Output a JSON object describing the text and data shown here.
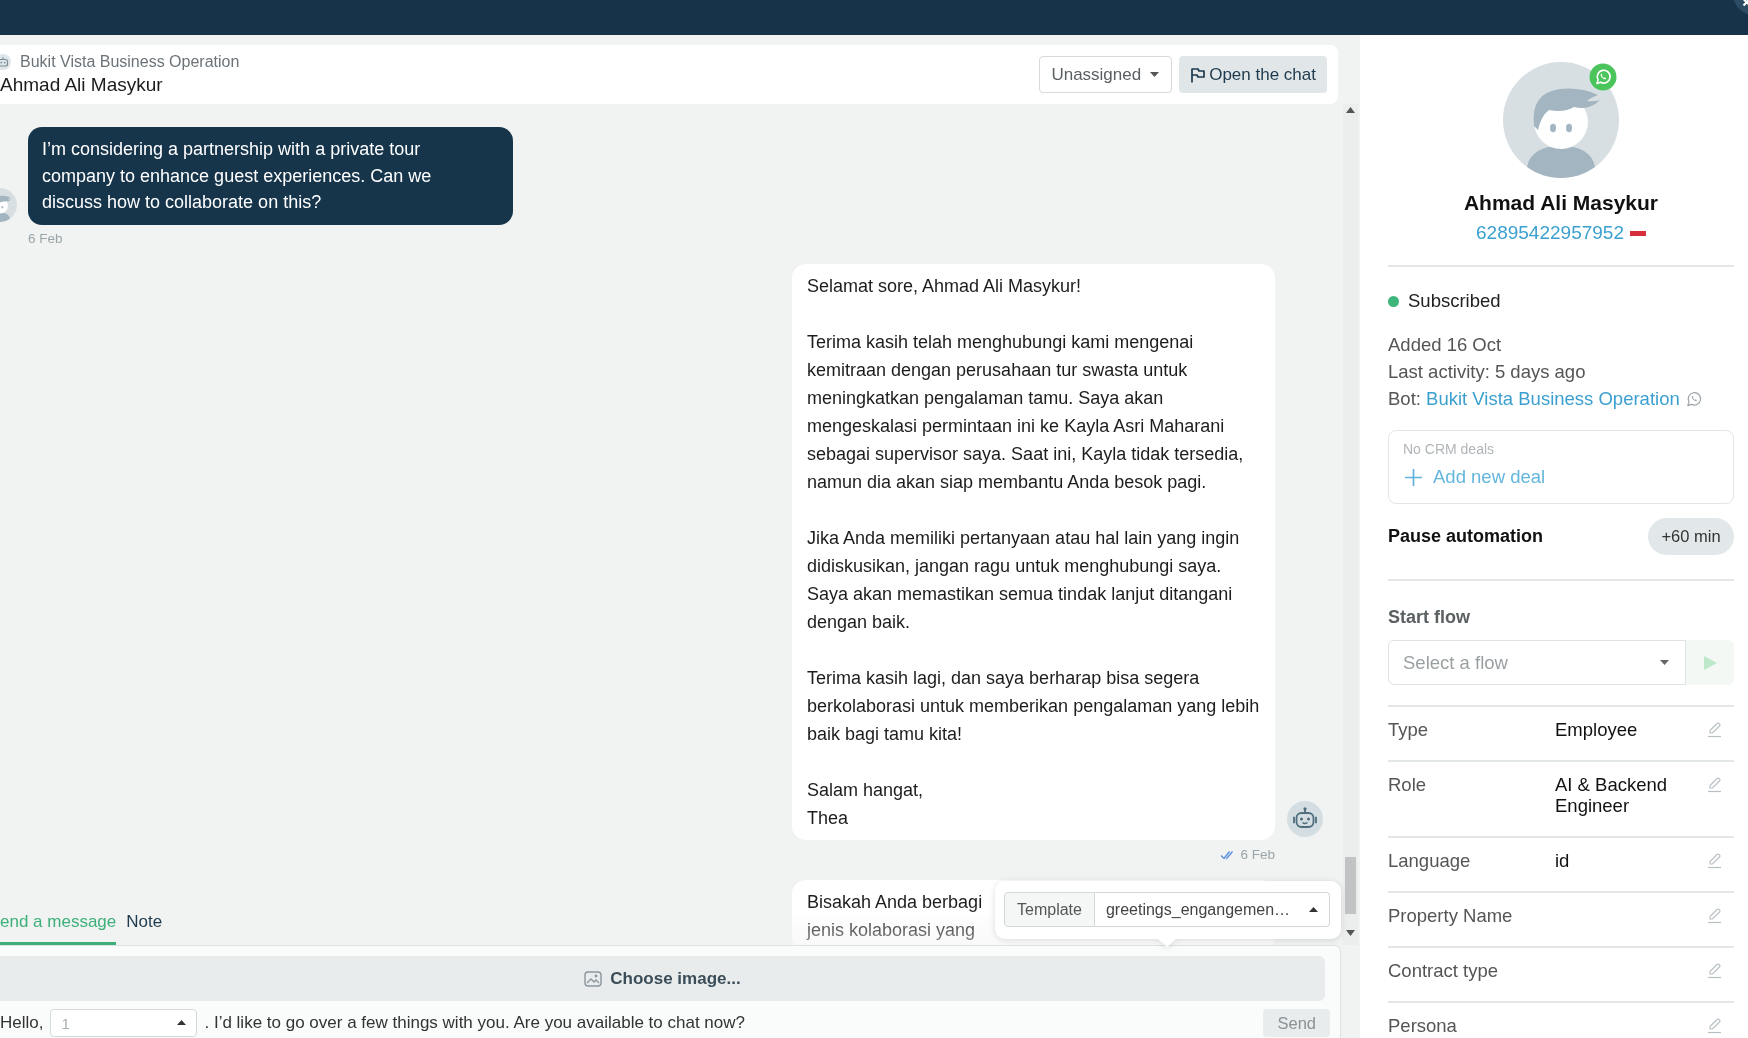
{
  "chat_header": {
    "bot_name": "Bukit Vista Business Operation",
    "contact_name": "Ahmad Ali Masykur",
    "assignee": "Unassigned",
    "open_button": "Open the chat"
  },
  "messages": [
    {
      "kind": "incoming",
      "avatar": {
        "kind": "user"
      },
      "text": "I’m considering a partnership with a private tour company to enhance guest experiences. Can we discuss how to collaborate on this?",
      "time": "6 Feb"
    },
    {
      "kind": "outgoing",
      "avatar": {
        "kind": "bot"
      },
      "text": "Selamat sore, Ahmad Ali Masykur!\n\nTerima kasih telah menghubungi kami mengenai kemitraan dengan perusahaan tur swasta untuk meningkatkan pengalaman tamu. Saya akan mengeskalasi permintaan ini ke Kayla Asri Maharani sebagai supervisor saya. Saat ini, Kayla tidak tersedia, namun dia akan siap membantu Anda besok pagi.\n\nJika Anda memiliki pertanyaan atau hal lain yang ingin didiskusikan, jangan ragu untuk menghubungi saya. Saya akan memastikan semua tindak lanjut ditangani dengan baik.\n\nTerima kasih lagi, dan saya berharap bisa segera berkolaborasi untuk memberikan pengalaman yang lebih baik bagi tamu kita!\n\nSalam hangat,\nThea",
      "time": "6 Feb",
      "read": true
    },
    {
      "kind": "outgoing",
      "text": "Bisakah Anda berbagi\njenis kolaborasi yang"
    }
  ],
  "composer": {
    "tabs": [
      {
        "label": "end a message",
        "selected": true
      },
      {
        "label": "Note",
        "selected": false
      }
    ],
    "template": {
      "label": "Template",
      "value": "greetings_engangemen…"
    },
    "image_button": "Choose image...",
    "template_text": [
      {
        "kind": "text",
        "text": "Hello,"
      },
      {
        "kind": "field",
        "placeholder": "1"
      },
      {
        "kind": "text",
        "text": ". I’d like to go over a few things with you. Are you available to chat now?"
      }
    ],
    "send": {
      "label": "Send",
      "disabled": true
    }
  },
  "contact": {
    "name": "Ahmad Ali Masykur",
    "phone": "62895422957952",
    "subscribed": true,
    "status_label": "Subscribed",
    "added": "Added 16 Oct",
    "last_activity": "Last activity: 5 days ago",
    "bot_label": "Bot:",
    "bot_name": "Bukit Vista Business Operation"
  },
  "crm": {
    "empty_text": "No CRM deals",
    "add_link": "Add new deal"
  },
  "pause_automation": {
    "label": "Pause automation",
    "button": "+60 min"
  },
  "start_flow": {
    "label": "Start flow",
    "placeholder": "Select a flow",
    "disabled": true
  },
  "fields": [
    {
      "label": "Type",
      "value": "Employee"
    },
    {
      "label": "Role",
      "value": "AI & Backend Engineer"
    },
    {
      "label": "Language",
      "value": "id"
    },
    {
      "label": "Property Name"
    },
    {
      "label": "Contract type"
    },
    {
      "label": "Persona"
    }
  ]
}
